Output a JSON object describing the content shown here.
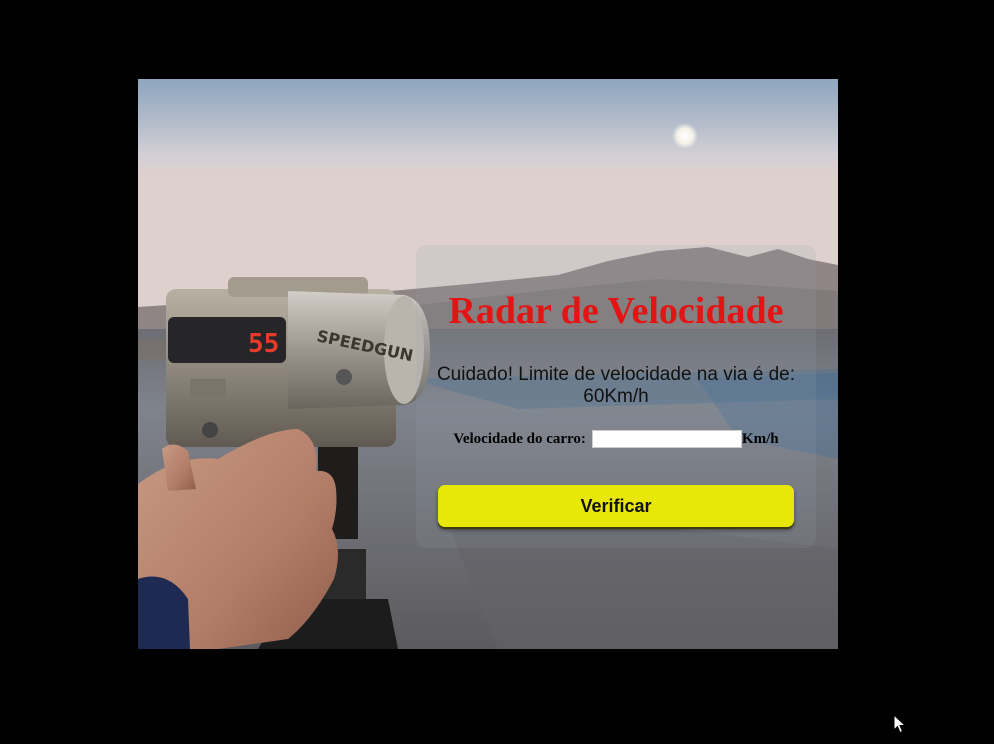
{
  "background": {
    "device_display_text": "55",
    "device_brand_text": "SPEEDGUN"
  },
  "radar": {
    "title": "Radar de Velocidade",
    "warning": "Cuidado! Limite de velocidade na via é de: 60Km/h",
    "speed_label": "Velocidade do carro:",
    "speed_value": "",
    "speed_unit": "Km/h",
    "verify_label": "Verificar"
  },
  "colors": {
    "page_background": "#000000",
    "title_color": "#e51414",
    "button_color": "#e8e808"
  }
}
